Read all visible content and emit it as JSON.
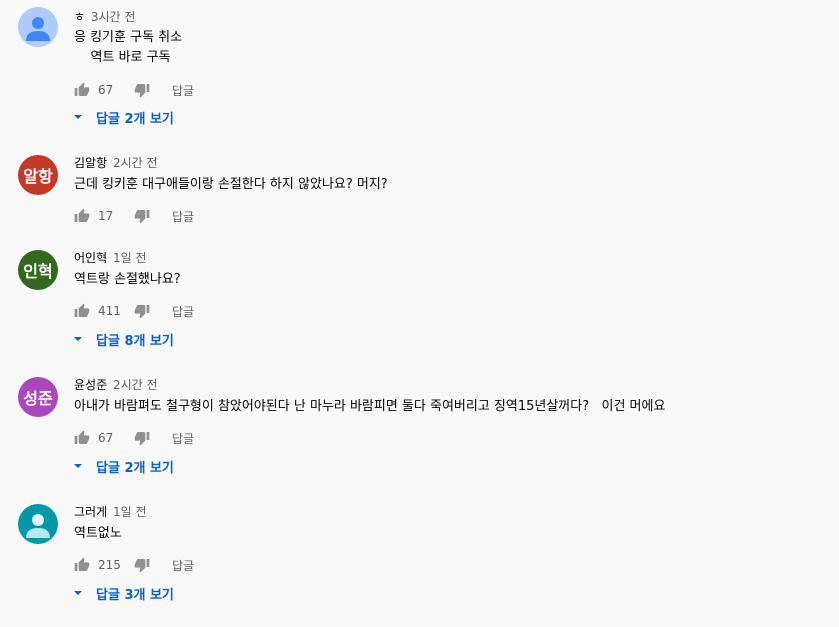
{
  "comments": [
    {
      "author": "ㅎ",
      "time": "3시간 전",
      "avatar_text": "",
      "avatar_color": "#aecbfa",
      "avatar_icon": "person-icon",
      "text": "응 킹기훈 구독 취소\n    역트 바로 구독",
      "likes": "67",
      "reply_label": "답글",
      "replies_label": "답글 2개 보기"
    },
    {
      "author": "김알항",
      "time": "2시간 전",
      "avatar_text": "알항",
      "avatar_color": "#c53929",
      "text": "근데 킹키훈 대구애들이랑 손절한다 하지 않았나요? 머지?",
      "likes": "17",
      "reply_label": "답글",
      "replies_label": ""
    },
    {
      "author": "어인혁",
      "time": "1일 전",
      "avatar_text": "인혁",
      "avatar_color": "#33691e",
      "text": "역트랑 손절했나요?",
      "likes": "411",
      "reply_label": "답글",
      "replies_label": "답글 8개 보기"
    },
    {
      "author": "윤성준",
      "time": "2시간 전",
      "avatar_text": "성준",
      "avatar_color": "#ab47bc",
      "text": "아내가 바람펴도 철구형이 참았어야된다 난 마누라 바람피면 둘다 죽여버리고 징역15년살꺼다?   이건 머에요",
      "likes": "67",
      "reply_label": "답글",
      "replies_label": "답글 2개 보기"
    },
    {
      "author": "그러게",
      "time": "1일 전",
      "avatar_text": "",
      "avatar_color": "#0097a7",
      "avatar_icon": "person-icon",
      "text": "역트없노",
      "likes": "215",
      "reply_label": "답글",
      "replies_label": "답글 3개 보기"
    }
  ],
  "colors": {
    "link": "#065fd4",
    "secondary": "#606060",
    "background": "#f9f9f9"
  }
}
